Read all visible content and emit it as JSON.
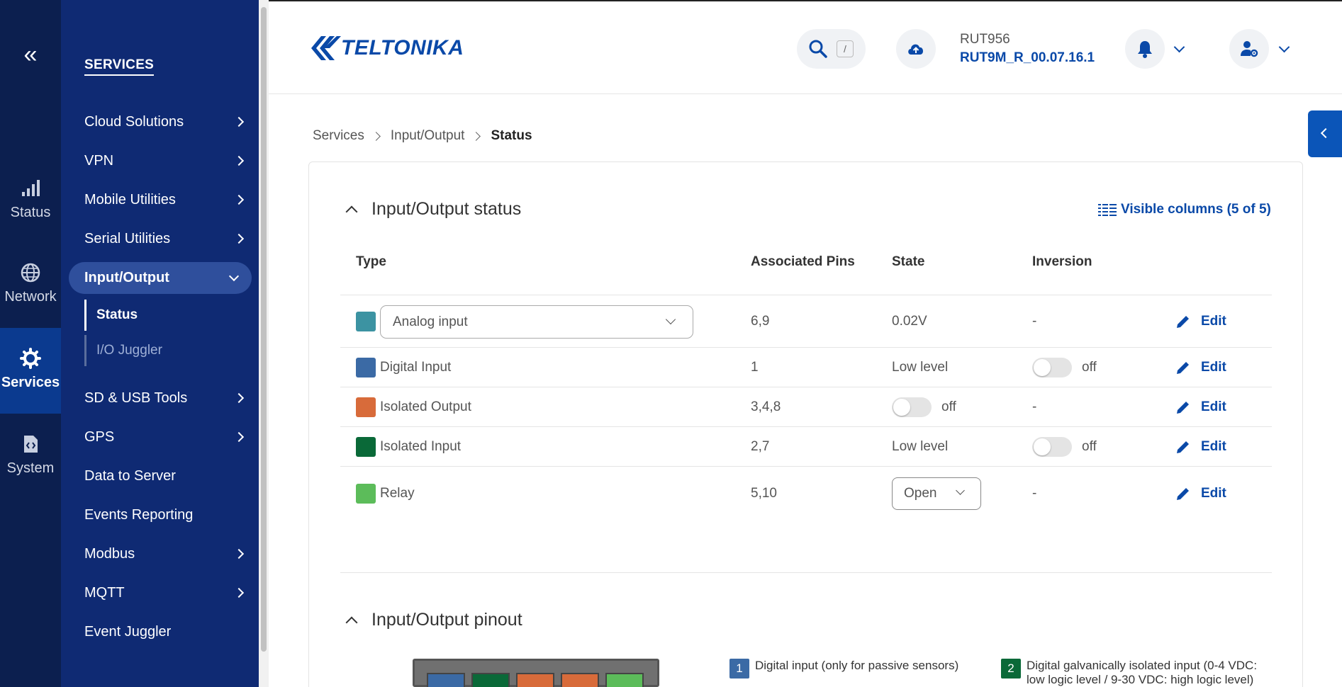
{
  "colors": {
    "rail_bg": "#0c1f4f",
    "sidebar_bg": "#0f2a73",
    "accent": "#0a49a8",
    "analog": "#3c93a2",
    "digital_input": "#3b6aa5",
    "isolated_output": "#d86b3a",
    "isolated_input": "#0a6938",
    "relay": "#5cbc5a"
  },
  "rail": {
    "items": [
      {
        "label": "Status",
        "icon": "signal-bars-icon"
      },
      {
        "label": "Network",
        "icon": "globe-icon"
      },
      {
        "label": "Services",
        "icon": "gear-icon"
      },
      {
        "label": "System",
        "icon": "code-file-icon"
      }
    ]
  },
  "sidebar": {
    "title": "SERVICES",
    "items": [
      {
        "label": "Cloud Solutions"
      },
      {
        "label": "VPN"
      },
      {
        "label": "Mobile Utilities"
      },
      {
        "label": "Serial Utilities"
      },
      {
        "label": "Input/Output"
      },
      {
        "label": "SD & USB Tools"
      },
      {
        "label": "GPS"
      },
      {
        "label": "Data to Server"
      },
      {
        "label": "Events Reporting"
      },
      {
        "label": "Modbus"
      },
      {
        "label": "MQTT"
      },
      {
        "label": "Event Juggler"
      }
    ],
    "subitems": [
      {
        "label": "Status"
      },
      {
        "label": "I/O Juggler"
      }
    ]
  },
  "header": {
    "logo_text": "TELTONIKA",
    "search_shortcut": "/",
    "device_model": "RUT956",
    "firmware": "RUT9M_R_00.07.16.1"
  },
  "breadcrumb": [
    "Services",
    "Input/Output",
    "Status"
  ],
  "io_status": {
    "title": "Input/Output status",
    "visible_columns": "Visible columns (5 of 5)",
    "columns": [
      "Type",
      "Associated Pins",
      "State",
      "Inversion"
    ],
    "rows": [
      {
        "type": "Analog input",
        "pins": "6,9",
        "state": "0.02V",
        "inversion": "-",
        "action": "Edit"
      },
      {
        "type": "Digital Input",
        "pins": "1",
        "state": "Low level",
        "inversion": "off",
        "action": "Edit"
      },
      {
        "type": "Isolated Output",
        "pins": "3,4,8",
        "state": "off",
        "inversion": "-",
        "action": "Edit"
      },
      {
        "type": "Isolated Input",
        "pins": "2,7",
        "state": "Low level",
        "inversion": "off",
        "action": "Edit"
      },
      {
        "type": "Relay",
        "pins": "5,10",
        "state": "Open",
        "inversion": "-",
        "action": "Edit"
      }
    ]
  },
  "io_pinout": {
    "title": "Input/Output pinout",
    "legend": [
      {
        "num": "1",
        "text": "Digital input (only for passive sensors)"
      },
      {
        "num": "2",
        "text": "Digital galvanically isolated input (0-4 VDC: low logic level / 9-30 VDC: high logic level)"
      }
    ]
  }
}
